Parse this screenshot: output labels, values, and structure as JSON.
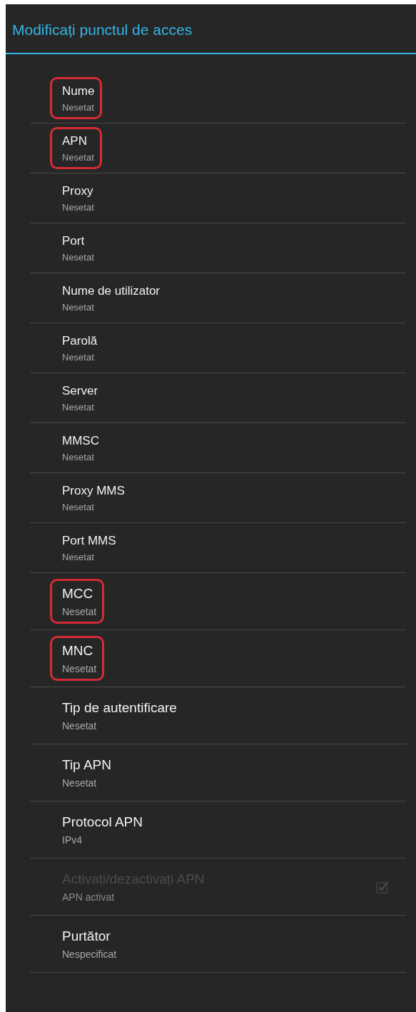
{
  "title": "Modificați punctul de acces",
  "settings": [
    {
      "kind": "text",
      "label": "Nume",
      "value": "Nesetat",
      "highlighted": true
    },
    {
      "kind": "text",
      "label": "APN",
      "value": "Nesetat",
      "highlighted": true
    },
    {
      "kind": "text",
      "label": "Proxy",
      "value": "Nesetat",
      "highlighted": false
    },
    {
      "kind": "text",
      "label": "Port",
      "value": "Nesetat",
      "highlighted": false
    },
    {
      "kind": "text",
      "label": "Nume de utilizator",
      "value": "Nesetat",
      "highlighted": false
    },
    {
      "kind": "text",
      "label": "Parolă",
      "value": "Nesetat",
      "highlighted": false
    },
    {
      "kind": "text",
      "label": "Server",
      "value": "Nesetat",
      "highlighted": false
    },
    {
      "kind": "text",
      "label": "MMSC",
      "value": "Nesetat",
      "highlighted": false
    },
    {
      "kind": "text",
      "label": "Proxy MMS",
      "value": "Nesetat",
      "highlighted": false
    },
    {
      "kind": "text",
      "label": "Port MMS",
      "value": "Nesetat",
      "highlighted": false
    },
    {
      "kind": "text",
      "label": "MCC",
      "value": "Nesetat",
      "highlighted": true
    },
    {
      "kind": "text",
      "label": "MNC",
      "value": "Nesetat",
      "highlighted": true
    },
    {
      "kind": "text",
      "label": "Tip de autentificare",
      "value": "Nesetat",
      "highlighted": false
    },
    {
      "kind": "text",
      "label": "Tip APN",
      "value": "Nesetat",
      "highlighted": false
    },
    {
      "kind": "text",
      "label": "Protocol APN",
      "value": "IPv4",
      "highlighted": false
    },
    {
      "kind": "checkbox",
      "label": "Activați/dezactivați APN",
      "value": "APN activat",
      "highlighted": false,
      "disabled": true,
      "checked": true
    },
    {
      "kind": "text",
      "label": "Purtător",
      "value": "Nespecificat",
      "highlighted": false
    }
  ]
}
